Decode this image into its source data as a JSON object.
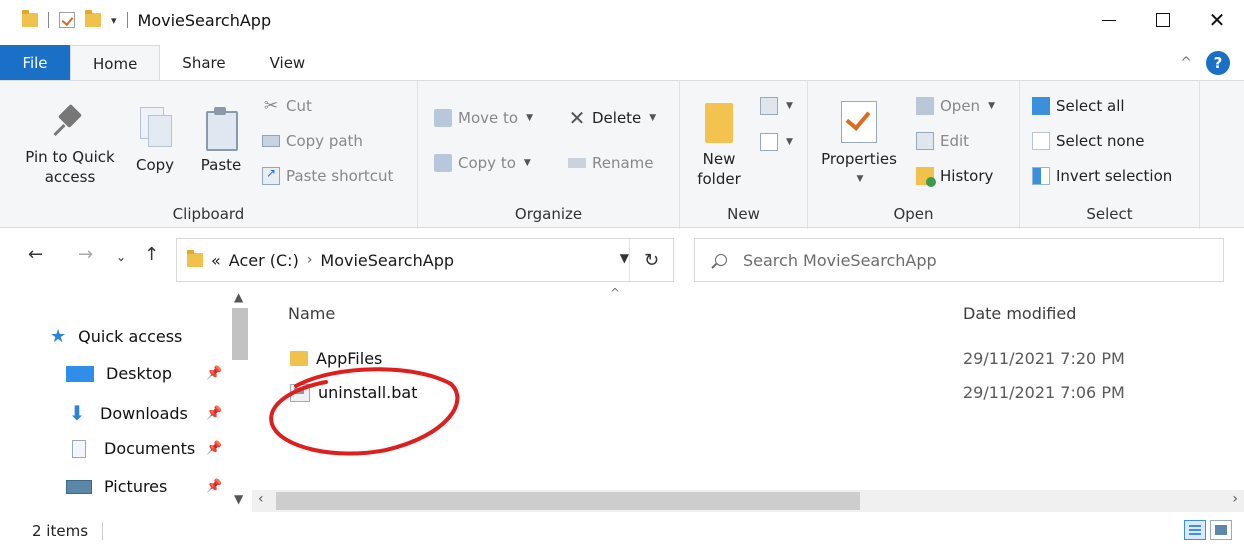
{
  "window": {
    "title": "MovieSearchApp",
    "controls": {
      "minimize": "—",
      "maximize": "☐",
      "close": "✕"
    }
  },
  "tabs": [
    "File",
    "Home",
    "Share",
    "View"
  ],
  "ribbon": {
    "clipboard": {
      "label": "Clipboard",
      "pin": "Pin to Quick access",
      "copy": "Copy",
      "paste": "Paste",
      "cut": "Cut",
      "copy_path": "Copy path",
      "paste_shortcut": "Paste shortcut"
    },
    "organize": {
      "label": "Organize",
      "move_to": "Move to",
      "copy_to": "Copy to",
      "delete": "Delete",
      "rename": "Rename"
    },
    "new": {
      "label": "New",
      "new_folder": "New folder"
    },
    "open": {
      "label": "Open",
      "properties": "Properties",
      "open": "Open",
      "edit": "Edit",
      "history": "History"
    },
    "select": {
      "label": "Select",
      "select_all": "Select all",
      "select_none": "Select none",
      "invert_selection": "Invert selection"
    }
  },
  "address": {
    "overflow": "«",
    "crumbs": [
      "Acer (C:)",
      "MovieSearchApp"
    ],
    "separator": "›"
  },
  "search": {
    "placeholder": "Search MovieSearchApp"
  },
  "nav_pane": {
    "items": [
      {
        "label": "Quick access",
        "icon": "star-icon"
      },
      {
        "label": "Desktop",
        "icon": "desktop-icon",
        "pinned": true
      },
      {
        "label": "Downloads",
        "icon": "download-icon",
        "pinned": true
      },
      {
        "label": "Documents",
        "icon": "documents-icon",
        "pinned": true
      },
      {
        "label": "Pictures",
        "icon": "pictures-icon",
        "pinned": true
      }
    ]
  },
  "file_list": {
    "columns": {
      "name": "Name",
      "date": "Date modified"
    },
    "rows": [
      {
        "name": "AppFiles",
        "date": "29/11/2021 7:20 PM",
        "icon": "folder-icon"
      },
      {
        "name": "uninstall.bat",
        "date": "29/11/2021 7:06 PM",
        "icon": "batch-file-icon"
      }
    ]
  },
  "status": {
    "count": "2 items"
  },
  "colors": {
    "accent": "#1a6fc6",
    "annotation": "#e01e1e",
    "folder": "#f0c14b"
  }
}
